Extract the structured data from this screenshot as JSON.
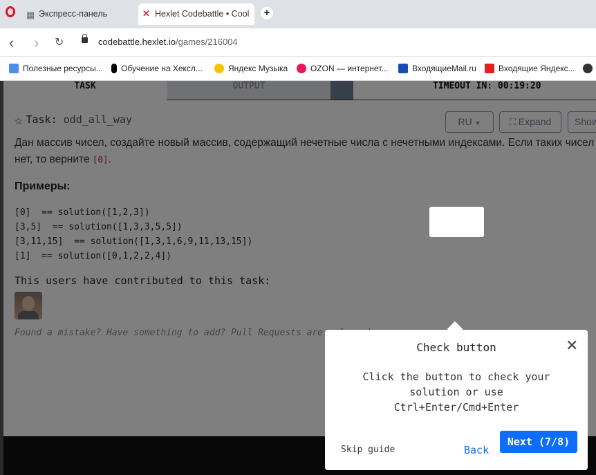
{
  "browser": {
    "tabs": [
      {
        "label": "Экспресс-панель"
      },
      {
        "label": "Hexlet Codebattle • Cool c"
      }
    ],
    "new_tab": "+",
    "url_domain": "codebattle.hexlet.io",
    "url_path": "/games/216004",
    "nav": {
      "back": "‹",
      "forward": "›",
      "reload": "↻"
    },
    "bookmarks": [
      {
        "label": "Полезные ресурсы...",
        "color": "#4a8ee8"
      },
      {
        "label": "Обучение на Хексл...",
        "color": "#000000"
      },
      {
        "label": "Яндекс Музыка",
        "color": "#f5c400"
      },
      {
        "label": "OZON — интернет...",
        "color": "#e8195a"
      },
      {
        "label": "ВходящиеMail.ru",
        "color": "#1a4db3"
      },
      {
        "label": "Входящие Яндекс...",
        "color": "#e0241b"
      }
    ]
  },
  "game": {
    "tabs": {
      "task": "TASK",
      "output": "OUTPUT"
    },
    "timeout": "TIMEOUT IN: 00:19:20",
    "task_label": "Task:",
    "task_name": "odd_all_way",
    "lang_button": "RU",
    "expand_button": "Expand",
    "show_button": "Show",
    "description": "Дан массив чисел, создайте новый массив, содержащий нечетные числа с нечетными индексами. Если таких чисел нет, то верните",
    "description_code": "[0]",
    "description_end": ".",
    "examples_title": "Примеры:",
    "examples": [
      "[0]  == solution([1,2,3])",
      "[3,5]  == solution([1,3,3,5,5])",
      "[3,11,15]  == solution([1,3,1,6,9,11,13,15])",
      "[1]  == solution([0,1,2,2,4])"
    ],
    "contributors_title": "This users have contributed to this task:",
    "found_mistake": "Found a mistake? Have something to add? Pull Requests are welcome!"
  },
  "guide": {
    "title": "Check button",
    "close": "✕",
    "body": "Click the button to check your solution or use Ctrl+Enter/Cmd+Enter",
    "skip": "Skip guide",
    "back": "Back",
    "next": "Next (7/8)"
  }
}
